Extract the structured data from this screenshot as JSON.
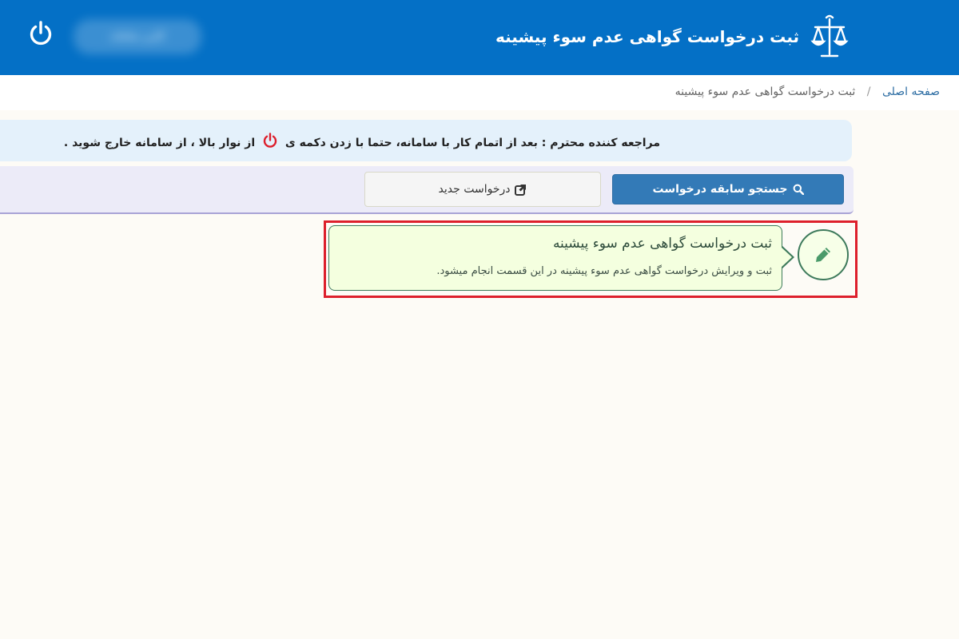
{
  "header": {
    "title": "ثبت درخواست گواهی عدم سوء پیشینه",
    "user_name": "کاربر سامانه"
  },
  "breadcrumb": {
    "home": "صفحه اصلی",
    "separator": "/",
    "current": "ثبت درخواست گواهی عدم سوء پیشینه"
  },
  "alert": {
    "text_before_icon": "مراجعه کننده محترم : بعد از اتمام کار با سامانه، حتما با زدن دکمه ی",
    "text_after_icon": "از نوار بالا ، از سامانه خارج شوید ."
  },
  "toolbar": {
    "search_label": "جستجو سابقه درخواست",
    "new_label": "درخواست جدید"
  },
  "card": {
    "title": "ثبت درخواست گواهی عدم سوء پیشینه",
    "description": "ثبت و ویرایش درخواست گواهی عدم سوء پیشینه در این قسمت انجام میشود."
  },
  "colors": {
    "header_bg": "#0470c6",
    "primary_button": "#337ab7",
    "alert_bg": "#e4f1fb",
    "card_bg": "#f4ffdf",
    "highlight_border": "#dd1f2c",
    "power_icon_alert": "#dd1f2c"
  },
  "icons": {
    "logo": "scales-of-justice-icon",
    "logout": "power-icon",
    "search": "search-icon",
    "new_request": "external-link-icon",
    "card": "pencil-icon"
  }
}
